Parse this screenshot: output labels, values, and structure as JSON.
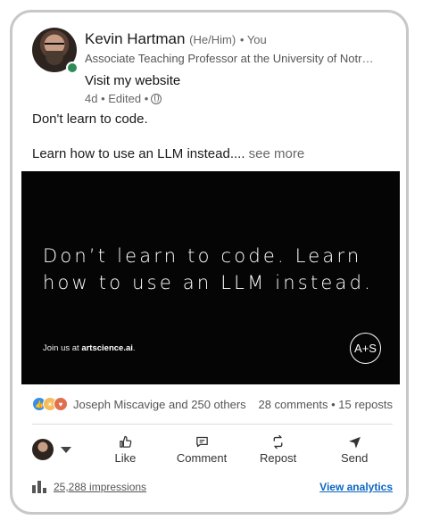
{
  "author": {
    "name": "Kevin Hartman",
    "pronouns": "(He/Him)",
    "relation": "• You",
    "headline": "Associate Teaching Professor at the University of Notre …",
    "website_link": "Visit my website",
    "meta": "4d • Edited •",
    "online": true
  },
  "post": {
    "line1": "Don't learn to code.",
    "line2": "Learn how to use an LLM instead.",
    "ellipsis": "...",
    "see_more": " see more"
  },
  "banner": {
    "headline_line1": "Don’t learn to code. Learn",
    "headline_line2": "how to use an LLM instead.",
    "join_prefix": "Join us at ",
    "join_site": "artscience.ai",
    "join_suffix": ".",
    "logo_text": "A+S",
    "background": "#050505"
  },
  "social": {
    "reaction_icons": [
      "like-icon",
      "insightful-icon",
      "love-icon"
    ],
    "reactors": "Joseph Miscavige and 250 others",
    "counts": "28 comments • 15 reposts"
  },
  "actions": {
    "like": "Like",
    "comment": "Comment",
    "repost": "Repost",
    "send": "Send"
  },
  "footer": {
    "impressions": "25,288 impressions",
    "view_analytics": "View analytics"
  },
  "colors": {
    "link_blue": "#0a66c2",
    "online_green": "#2e8b57",
    "card_border": "#c8c8c8"
  }
}
